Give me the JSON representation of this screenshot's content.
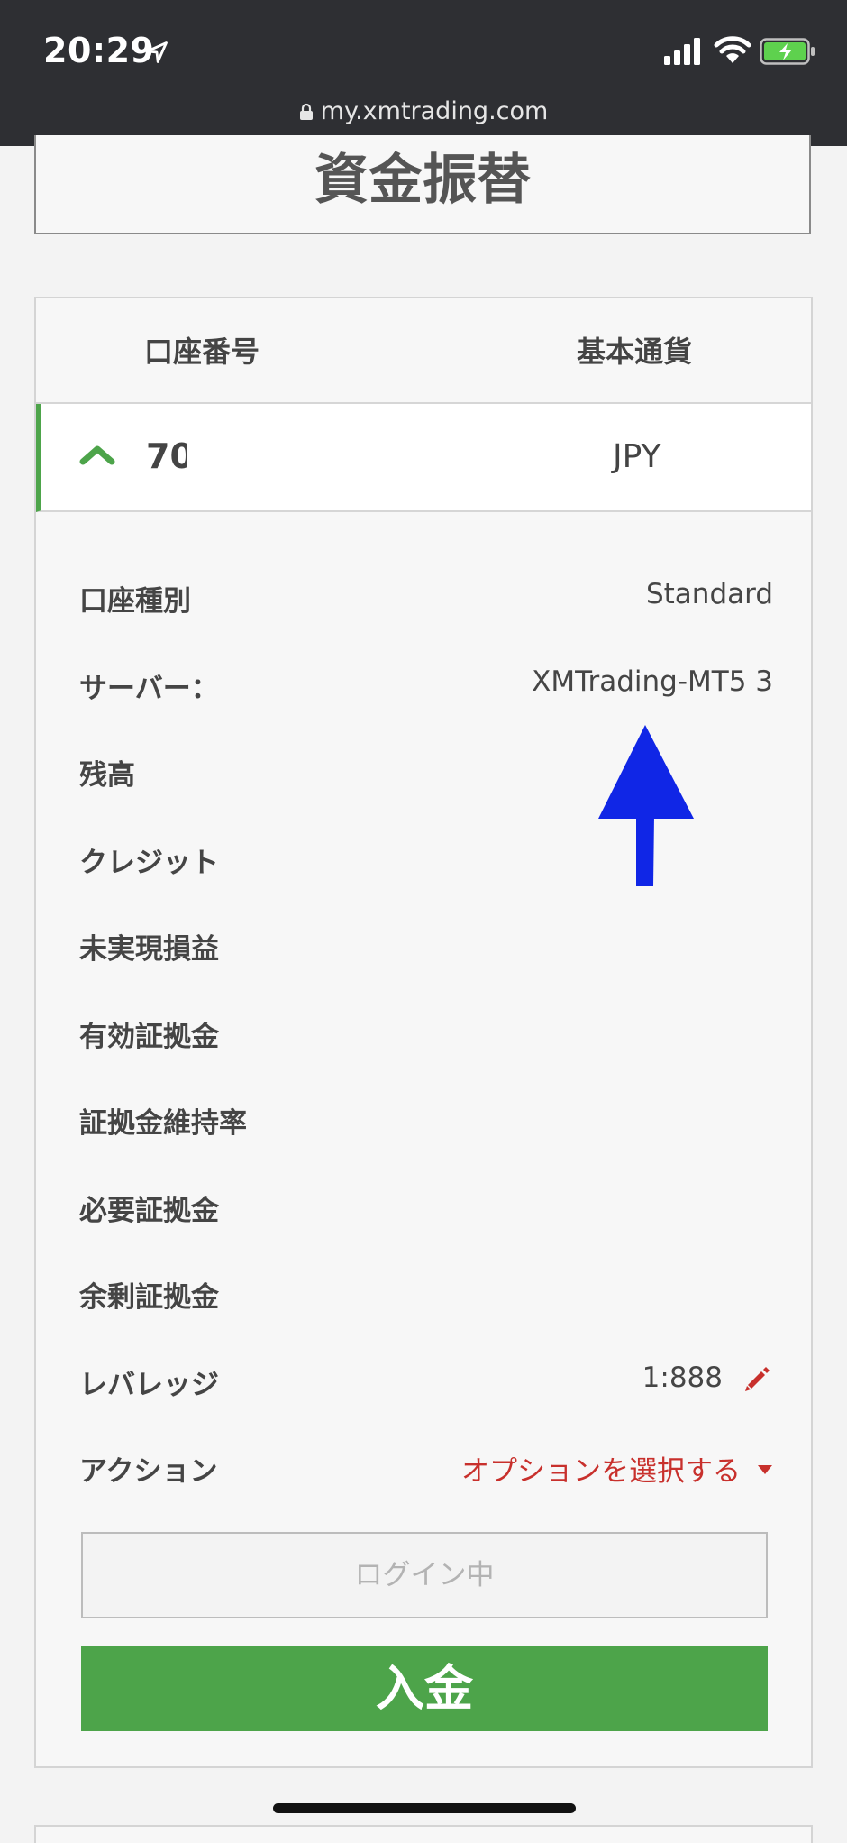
{
  "status_bar": {
    "time": "20:29",
    "icons": [
      "location-arrow-icon",
      "signal-icon",
      "wifi-icon",
      "battery-charging-icon"
    ]
  },
  "browser": {
    "url": "my.xmtrading.com"
  },
  "page": {
    "title": "資金振替"
  },
  "table": {
    "headers": {
      "account_number": "口座番号",
      "base_currency": "基本通貨"
    },
    "account": {
      "number": "70",
      "currency": "JPY"
    }
  },
  "details": {
    "account_type": {
      "label": "口座種別",
      "value": "Standard"
    },
    "server": {
      "label": "サーバー：",
      "value": "XMTrading-MT5 3"
    },
    "balance": {
      "label": "残高"
    },
    "credit": {
      "label": "クレジット"
    },
    "unrealized_pl": {
      "label": "未実現損益"
    },
    "equity": {
      "label": "有効証拠金"
    },
    "margin_level": {
      "label": "証拠金維持率"
    },
    "required_margin": {
      "label": "必要証拠金"
    },
    "free_margin": {
      "label": "余剰証拠金"
    },
    "leverage": {
      "label": "レバレッジ",
      "value": "1:888"
    },
    "action": {
      "label": "アクション",
      "value": "オプションを選択する"
    }
  },
  "buttons": {
    "login": "ログイン中",
    "deposit": "入金"
  },
  "colors": {
    "accent_green": "#4da44a",
    "action_red": "#c8302c",
    "annotation_blue": "#1026e6",
    "statusbar_bg": "#2e2f33"
  }
}
